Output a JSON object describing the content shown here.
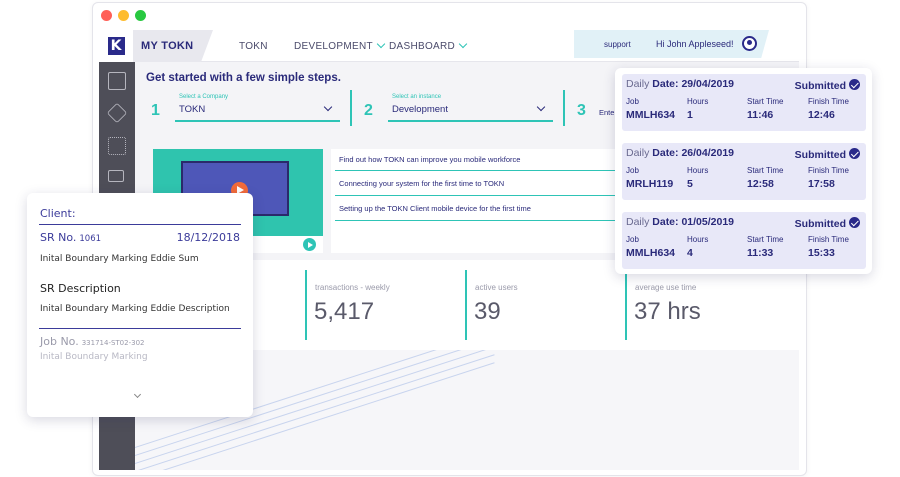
{
  "window": {
    "controls": [
      "close",
      "minimize",
      "maximize"
    ]
  },
  "header": {
    "logo_letter": "K",
    "brand": "MY TOKN",
    "nav": [
      "TOKN",
      "DEVELOPMENT",
      "DASHBOARD"
    ],
    "support": "support",
    "greeting": "Hi John Appleseed!"
  },
  "sidebar": {
    "icons": [
      "settings-icon",
      "layers-icon",
      "org-chart-icon",
      "screens-icon"
    ]
  },
  "getting_started": {
    "heading": "Get started with a few simple steps.",
    "steps": [
      {
        "number": "1",
        "label": "Select a Company",
        "value": "TOKN"
      },
      {
        "number": "2",
        "label": "Select an instance",
        "value": "Development"
      },
      {
        "number": "3",
        "value": "Ente"
      }
    ],
    "links": [
      "Find out how TOKN can improve you mobile workforce",
      "Connecting your system for the first time to TOKN",
      "Setting up the TOKN Client mobile device for the first time"
    ]
  },
  "stats": [
    {
      "label": "transactions - weekly",
      "value": "5,417"
    },
    {
      "label": "active users",
      "value": "39"
    },
    {
      "label": "average use time",
      "value": "37 hrs"
    }
  ],
  "client_card": {
    "client_label": "Client:",
    "sr_label": "SR No.",
    "sr_number": "1061",
    "date": "18/12/2018",
    "sr_text": "Inital Boundary Marking Eddie Sum",
    "desc_title": "SR Description",
    "desc_text": "Inital Boundary Marking Eddie Description",
    "job_label": "Job No.",
    "job_number": "331714-ST02-302",
    "job_text": "Inital Boundary Marking"
  },
  "daily_card": {
    "daily_word": "Daily",
    "date_prefix": "Date:",
    "col_labels": [
      "Job",
      "Hours",
      "Start Time",
      "Finish Time"
    ],
    "entries": [
      {
        "date": "29/04/2019",
        "status": "Submitted",
        "job": "MMLH634",
        "hours": "1",
        "start": "11:46",
        "finish": "12:46"
      },
      {
        "date": "26/04/2019",
        "status": "Submitted",
        "job": "MRLH119",
        "hours": "5",
        "start": "12:58",
        "finish": "17:58"
      },
      {
        "date": "01/05/2019",
        "status": "Submitted",
        "job": "MMLH634",
        "hours": "4",
        "start": "11:33",
        "finish": "15:33"
      }
    ]
  }
}
